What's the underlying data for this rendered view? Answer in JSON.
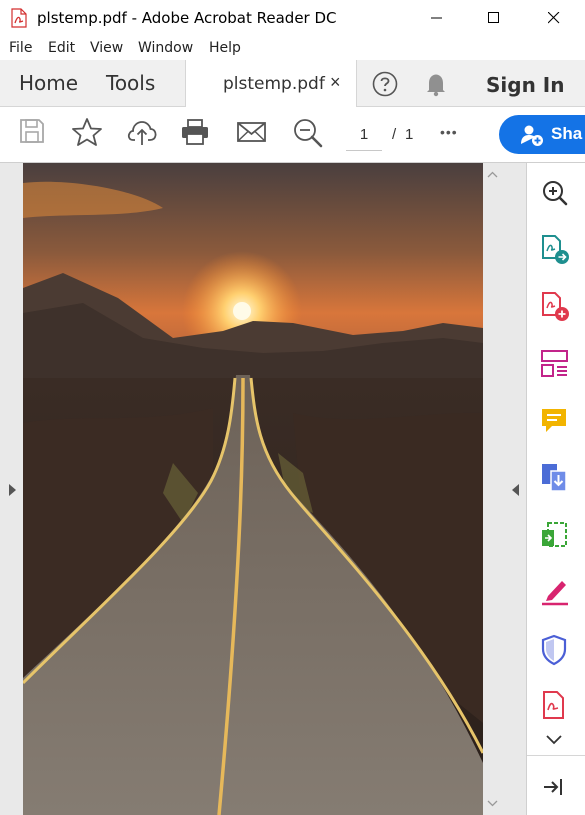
{
  "window": {
    "title": "plstemp.pdf - Adobe Acrobat Reader DC",
    "controls": [
      "minimize",
      "maximize",
      "close"
    ]
  },
  "menu": {
    "items": [
      "File",
      "Edit",
      "View",
      "Window",
      "Help"
    ]
  },
  "tabs": {
    "home": "Home",
    "tools": "Tools",
    "document": "plstemp.pdf",
    "close_glyph": "×",
    "sign_in": "Sign In"
  },
  "toolbar": {
    "current_page": "1",
    "page_separator": "/",
    "total_pages": "1",
    "more_glyph": "•••",
    "share_label": "Sha"
  },
  "document": {
    "content": "photograph of a road leading toward a sunset over mountains"
  },
  "right_panel": {
    "icons": [
      "zoom-search-icon",
      "export-pdf-icon",
      "create-pdf-icon",
      "organize-pages-icon",
      "comment-icon",
      "combine-files-icon",
      "scan-ocr-icon",
      "fill-sign-icon",
      "protect-icon",
      "pdf-document-icon",
      "chevron-down-icon",
      "collapse-panel-icon"
    ]
  },
  "colors": {
    "accent": "#1473e6",
    "tabbar_bg": "#f0f0f0",
    "rail_bg": "#e9e9e9"
  }
}
